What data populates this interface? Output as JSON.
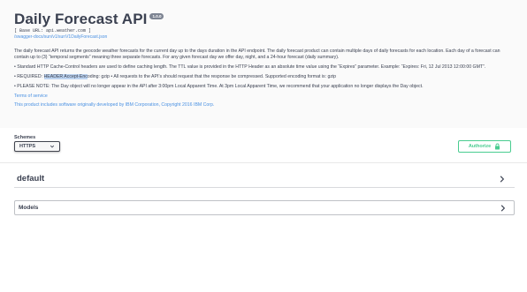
{
  "info": {
    "title": "Daily Forecast API",
    "version": "1.0.0",
    "base_url": "[ Base URL: api.weather.com ]",
    "spec_link": "/swagger-docs/sun/v1/sunV1DailyForecast.json",
    "description": {
      "p1": "The daily forecast API returns the geocode weather forecasts for the current day up to the days duration in the API endpoint. The daily forecast product can contain multiple days of daily forecasts for each location. Each day of a forecast can contain up to (3) “temporal segments” meaning three separate forecasts. For any given forecast day we offer day, night, and a 24-hour forecast (daily summary).",
      "p2": "• Standard HTTP Cache-Control headers are used to define caching length. The TTL value is provided in the HTTP Header as an absolute time value using the “Expires” parameter. Example: “Expires: Fri, 12 Jul 2013 12:00:00 GMT”.",
      "p3_prefix": "• REQUIRED: ",
      "p3_highlight": "HEADER Accept-Enc",
      "p3_suffix": "oding: gzip • All requests to the API’s should request that the response be compressed. Supported encoding format is: gzip",
      "p4": "• PLEASE NOTE: The Day object will no longer appear in the API after 3:00pm Local Apparent Time. At 3pm Local Apparent Time, we recommend that your application no longer displays the Day object."
    },
    "terms_link": "Terms of service",
    "ibm_link": "This product includes software originally developed by IBM Corporation, Copyright 2016 IBM Corp."
  },
  "schemes": {
    "label": "Schemes",
    "selected": "HTTPS"
  },
  "authorize": {
    "label": "Authorize",
    "icon": "lock-icon"
  },
  "tag": {
    "name": "default",
    "icon": "chevron-right-icon"
  },
  "models": {
    "label": "Models",
    "icon": "chevron-right-icon"
  },
  "colors": {
    "accent_green": "#49cc90",
    "link_blue": "#4990e2",
    "text": "#3b4151",
    "version_badge": "#7d8492"
  }
}
